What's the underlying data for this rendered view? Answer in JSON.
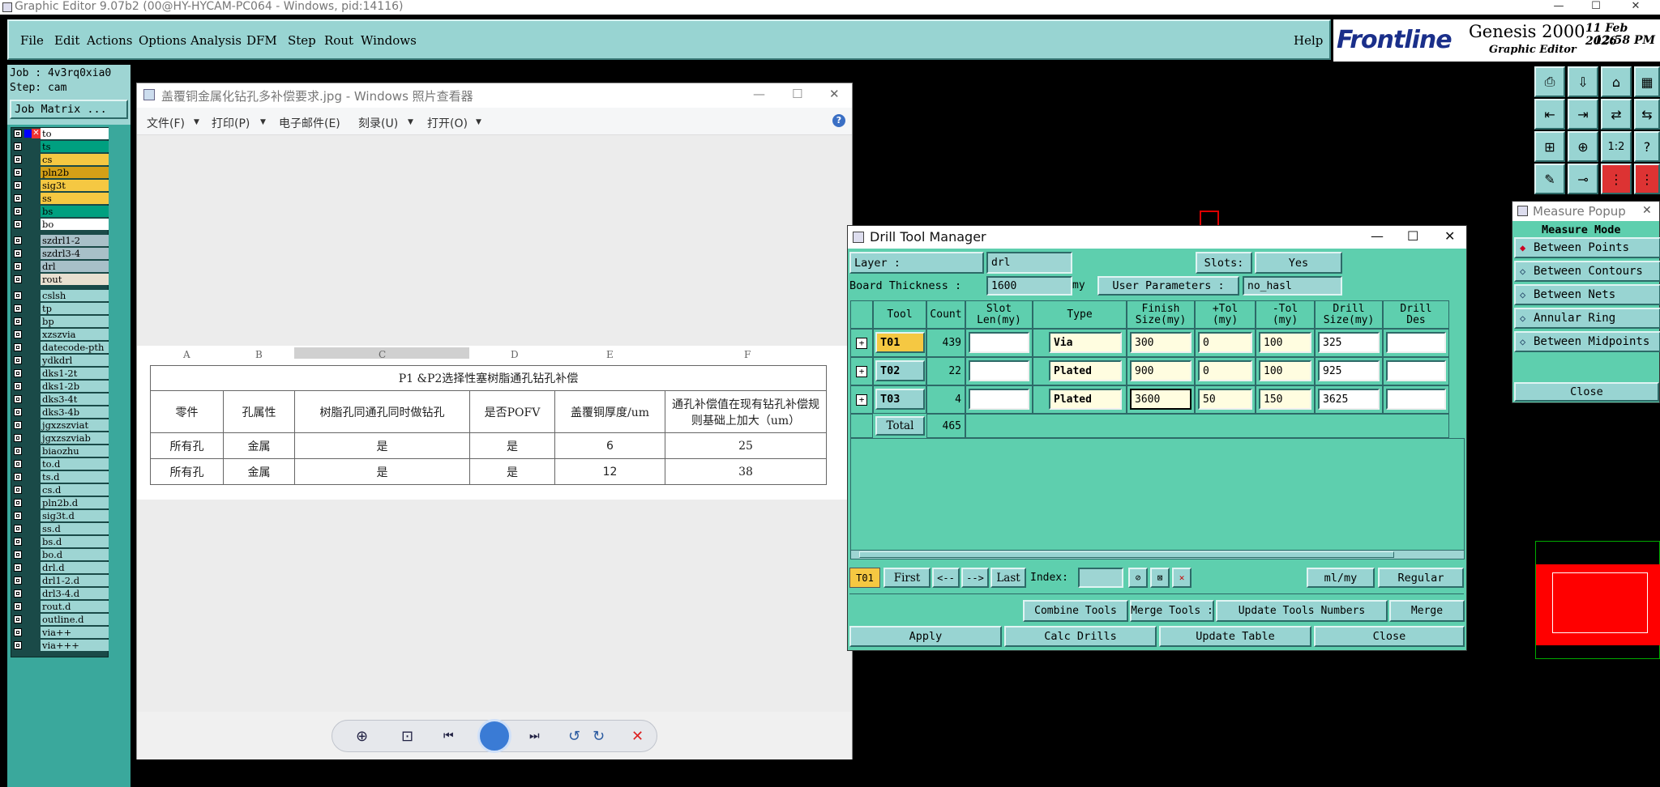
{
  "app": {
    "title": "Graphic Editor 9.07b2 (00@HY-HYCAM-PC064 - Windows, pid:14116)",
    "min": "—",
    "max": "☐",
    "close": "✕"
  },
  "menu": {
    "file": "File",
    "edit": "Edit",
    "actions": "Actions",
    "options": "Options",
    "analysis": "Analysis",
    "dfm": "DFM",
    "step": "Step",
    "rout": "Rout",
    "windows": "Windows",
    "help": "Help"
  },
  "logo": {
    "brand": "Frontline",
    "product": "Genesis 2000",
    "subtitle": "Graphic Editor",
    "date": "11 Feb 2026",
    "time": "12:58 PM"
  },
  "job": {
    "job": "Job : 4v3rq0xia0",
    "step": "Step: cam",
    "matrix_btn": "Job Matrix ..."
  },
  "layers": [
    {
      "name": "to",
      "color": "#ffffff"
    },
    {
      "name": "ts",
      "color": "#00a080"
    },
    {
      "name": "cs",
      "color": "#f5c842"
    },
    {
      "name": "pln2b",
      "color": "#d4a017"
    },
    {
      "name": "sig3t",
      "color": "#f5c842"
    },
    {
      "name": "ss",
      "color": "#f5c842"
    },
    {
      "name": "bs",
      "color": "#00a080"
    },
    {
      "name": "bo",
      "color": "#ffffff"
    },
    {
      "name": "szdrl1-2",
      "color": "#a8c0c8"
    },
    {
      "name": "szdrl3-4",
      "color": "#a8c0c8"
    },
    {
      "name": "drl",
      "color": "#a8c0c8"
    },
    {
      "name": "rout",
      "color": "#e8e0d0"
    },
    {
      "name": "cslsh",
      "color": "#9ed5d3"
    },
    {
      "name": "tp",
      "color": "#9ed5d3"
    },
    {
      "name": "bp",
      "color": "#9ed5d3"
    },
    {
      "name": "xzszvia",
      "color": "#9ed5d3"
    },
    {
      "name": "datecode-pth",
      "color": "#9ed5d3"
    },
    {
      "name": "ydkdrl",
      "color": "#9ed5d3"
    },
    {
      "name": "dks1-2t",
      "color": "#9ed5d3"
    },
    {
      "name": "dks1-2b",
      "color": "#9ed5d3"
    },
    {
      "name": "dks3-4t",
      "color": "#9ed5d3"
    },
    {
      "name": "dks3-4b",
      "color": "#9ed5d3"
    },
    {
      "name": "jgxzszviat",
      "color": "#9ed5d3"
    },
    {
      "name": "jgxzszviab",
      "color": "#9ed5d3"
    },
    {
      "name": "biaozhu",
      "color": "#9ed5d3"
    },
    {
      "name": "to.d",
      "color": "#9ed5d3"
    },
    {
      "name": "ts.d",
      "color": "#9ed5d3"
    },
    {
      "name": "cs.d",
      "color": "#9ed5d3"
    },
    {
      "name": "pln2b.d",
      "color": "#9ed5d3"
    },
    {
      "name": "sig3t.d",
      "color": "#9ed5d3"
    },
    {
      "name": "ss.d",
      "color": "#9ed5d3"
    },
    {
      "name": "bs.d",
      "color": "#9ed5d3"
    },
    {
      "name": "bo.d",
      "color": "#9ed5d3"
    },
    {
      "name": "drl.d",
      "color": "#9ed5d3"
    },
    {
      "name": "drl1-2.d",
      "color": "#9ed5d3"
    },
    {
      "name": "drl3-4.d",
      "color": "#9ed5d3"
    },
    {
      "name": "rout.d",
      "color": "#9ed5d3"
    },
    {
      "name": "outline.d",
      "color": "#9ed5d3"
    },
    {
      "name": "via++",
      "color": "#9ed5d3"
    },
    {
      "name": "via+++",
      "color": "#9ed5d3"
    }
  ],
  "photo": {
    "title": "盖覆铜金属化钻孔多补偿要求.jpg - Windows 照片查看器",
    "menu": {
      "file": "文件(F)",
      "print": "打印(P)",
      "email": "电子邮件(E)",
      "burn": "刻录(U)",
      "open": "打开(O)"
    },
    "cols": [
      "A",
      "B",
      "C",
      "D",
      "E",
      "F"
    ],
    "sheet_title": "P1 &P2选择性塞树脂通孔钻孔补偿",
    "headers": [
      "零件",
      "孔属性",
      "树脂孔同通孔同时做钻孔",
      "是否POFV",
      "盖覆铜厚度/um",
      "通孔补偿值在现有钻孔补偿规则基础上加大（um）"
    ],
    "rows": [
      [
        "所有孔",
        "金属",
        "是",
        "是",
        "6",
        "25"
      ],
      [
        "所有孔",
        "金属",
        "是",
        "是",
        "12",
        "38"
      ]
    ]
  },
  "dtm": {
    "title": "Drill Tool Manager",
    "layer_label": "Layer         :",
    "layer_value": "drl",
    "slots_label": "Slots:",
    "slots_value": "Yes",
    "thickness_label": "Board Thickness :",
    "thickness_value": "1600",
    "thickness_unit": "my",
    "user_params_label": "User Parameters :",
    "user_params_value": "no_hasl",
    "headers": {
      "tool": "Tool",
      "count": "Count",
      "slot": "Slot\nLen(my)",
      "type": "Type",
      "finish": "Finish\nSize(my)",
      "ptol": "+Tol\n(my)",
      "ntol": "-Tol\n(my)",
      "drill": "Drill\nSize(my)",
      "des": "Drill\nDes"
    },
    "rows": [
      {
        "tool": "T01",
        "count": "439",
        "slot": "",
        "type": "Via",
        "finish": "300",
        "ptol": "0",
        "ntol": "100",
        "drill": "325",
        "des": ""
      },
      {
        "tool": "T02",
        "count": "22",
        "slot": "",
        "type": "Plated",
        "finish": "900",
        "ptol": "0",
        "ntol": "100",
        "drill": "925",
        "des": ""
      },
      {
        "tool": "T03",
        "count": "4",
        "slot": "",
        "type": "Plated",
        "finish": "3600",
        "ptol": "50",
        "ntol": "150",
        "drill": "3625",
        "des": ""
      }
    ],
    "total_label": "Total",
    "total_count": "465",
    "nav": {
      "current": "T01",
      "first": "First",
      "prev": "<--",
      "next": "-->",
      "last": "Last",
      "index_label": "Index:",
      "units": "ml/my",
      "mode": "Regular"
    },
    "buttons": {
      "combine": "Combine Tools",
      "merge_label": "Merge Tools :",
      "update_numbers": "Update Tools Numbers",
      "merge": "Merge",
      "apply": "Apply",
      "calc": "Calc Drills",
      "update_table": "Update Table",
      "close": "Close"
    }
  },
  "measure": {
    "title": "Measure Popup",
    "mode_label": "Measure Mode",
    "options": [
      "Between Points",
      "Between Contours",
      "Between Nets",
      "Annular Ring",
      "Between Midpoints"
    ],
    "close": "Close"
  }
}
